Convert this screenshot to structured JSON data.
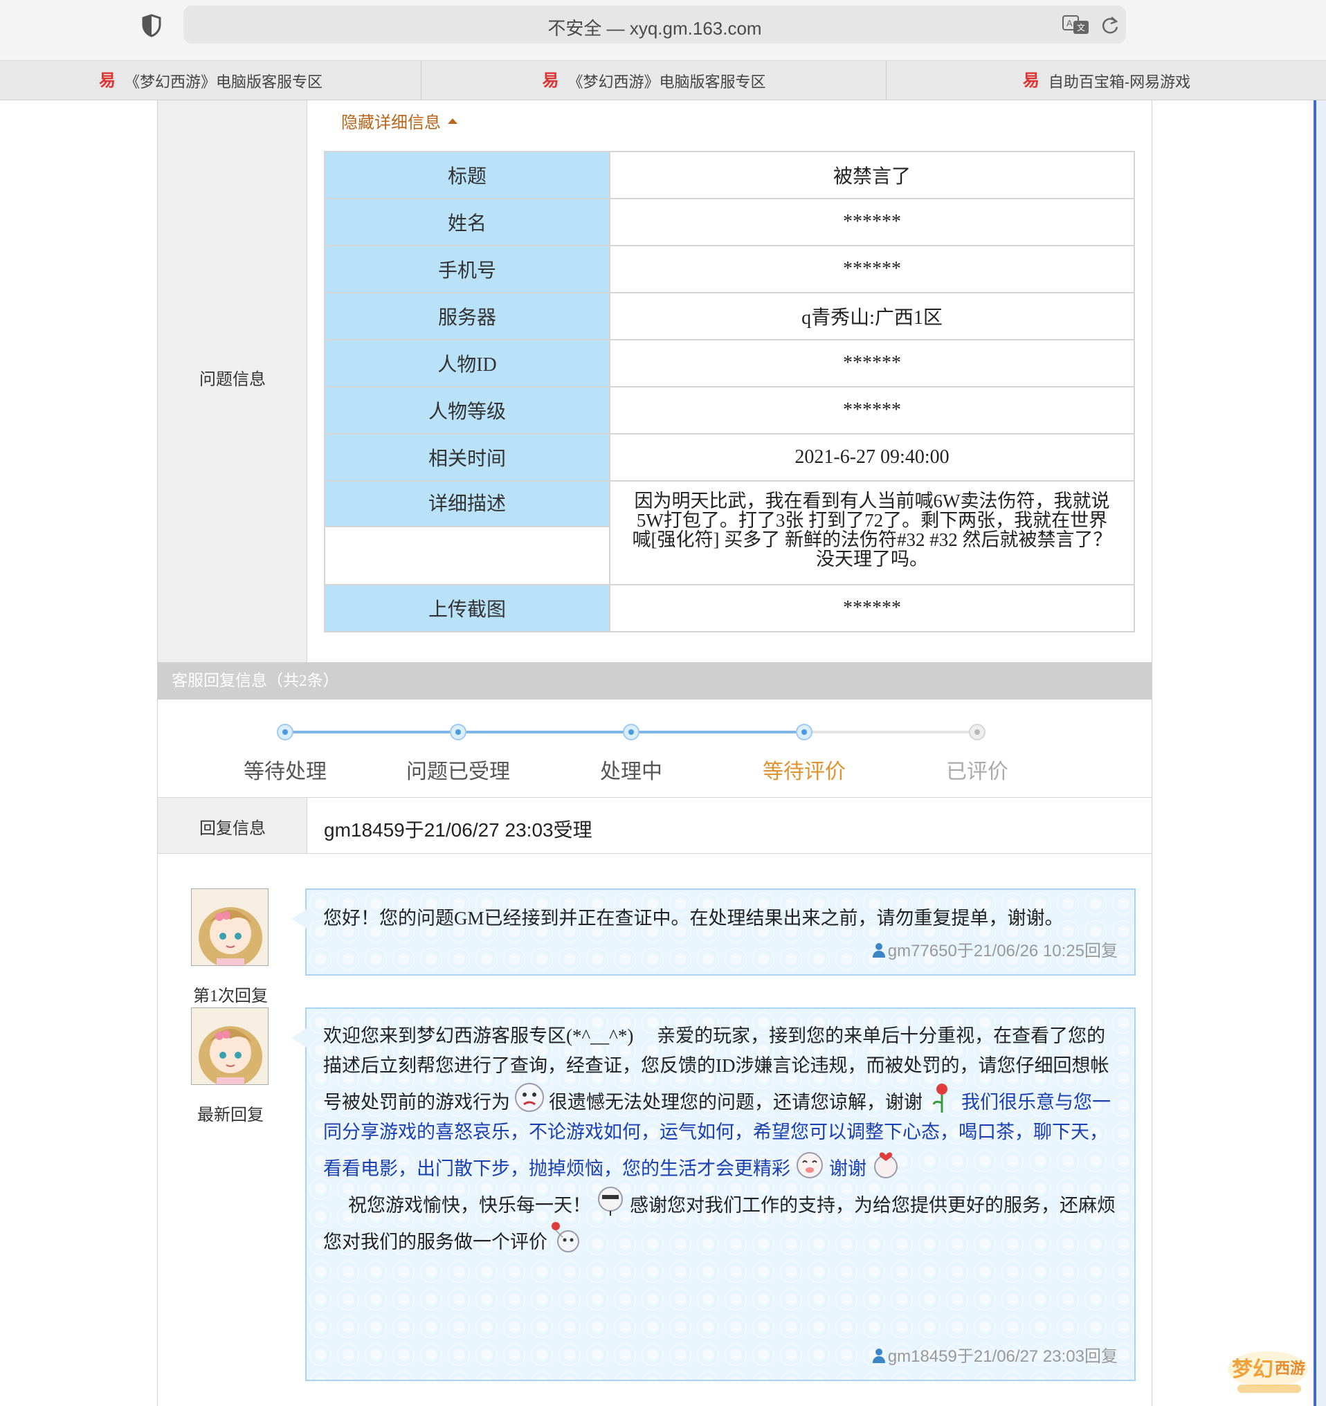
{
  "browser": {
    "url": "不安全 — xyq.gm.163.com",
    "tabs": [
      {
        "label": "《梦幻西游》电脑版客服专区"
      },
      {
        "label": "《梦幻西游》电脑版客服专区"
      },
      {
        "label": "自助百宝箱-网易游戏"
      }
    ]
  },
  "problem": {
    "section_label": "问题信息",
    "hide_link": "隐藏详细信息",
    "rows": [
      {
        "key": "标题",
        "value": "被禁言了"
      },
      {
        "key": "姓名",
        "value": "******"
      },
      {
        "key": "手机号",
        "value": "******"
      },
      {
        "key": "服务器",
        "value": "q青秀山:广西1区"
      },
      {
        "key": "人物ID",
        "value": "******"
      },
      {
        "key": "人物等级",
        "value": "******"
      },
      {
        "key": "相关时间",
        "value": "2021-6-27 09:40:00"
      },
      {
        "key": "详细描述",
        "value": "因为明天比武，我在看到有人当前喊6W卖法伤符，我就说5W打包了。打了3张 打到了72了。剩下两张，我就在世界喊[强化符] 买多了 新鲜的法伤符#32 #32 然后就被禁言了？没天理了吗。"
      },
      {
        "key": "上传截图",
        "value": "******"
      }
    ]
  },
  "service": {
    "section_title": "客服回复信息（共2条）",
    "steps": [
      "等待处理",
      "问题已受理",
      "处理中",
      "等待评价",
      "已评价"
    ],
    "current_step": 3,
    "reply_info_label": "回复信息",
    "reply_info_text": "gm18459于21/06/27 23:03受理",
    "replies": [
      {
        "caption": "第1次回复",
        "text": "您好！您的问题GM已经接到并正在查证中。在处理结果出来之前，请勿重复提单，谢谢。",
        "signature": "gm77650于21/06/26 10:25回复"
      },
      {
        "caption": "最新回复",
        "text_1": "欢迎您来到梦幻西游客服专区(*^__^*)　 亲爱的玩家，接到您的来单后十分重视，在查看了您的描述后立刻帮您进行了查询，经查证，您反馈的ID涉嫌言论违规，而被处罚的，请您仔细回想帐号被处罚前的游戏行为",
        "text_2": "很遗憾无法处理您的问题，还请您谅解，谢谢",
        "text_3_blue": "我们很乐意与您一同分享游戏的喜怒哀乐，不论游戏如何，运气如何，希望您可以调整下心态，喝口茶，聊下天，看看电影，出门散下步，抛掉烦恼，您的生活才会更精彩",
        "text_4_blue": "谢谢",
        "text_5": "祝您游戏愉快，快乐每一天！",
        "text_6": "感谢您对我们工作的支持，为给您提供更好的服务，还麻烦您对我们的服务做一个评价",
        "signature": "gm18459于21/06/27 23:03回复"
      }
    ]
  }
}
